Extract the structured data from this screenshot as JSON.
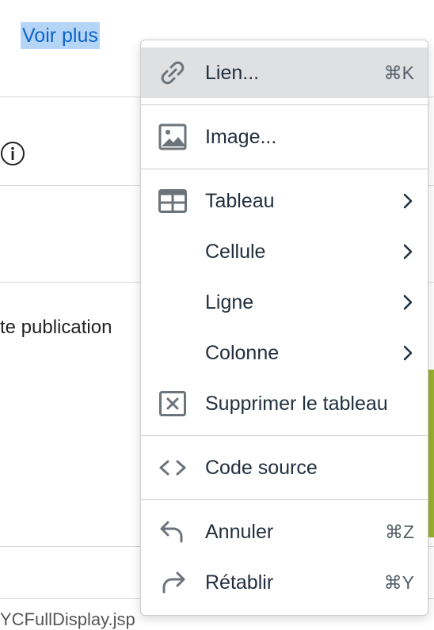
{
  "background": {
    "link_text": "Voir plus",
    "partial_text": "te publication",
    "bottom_text": "YCFullDisplay.jsp"
  },
  "menu": {
    "link": {
      "label": "Lien...",
      "shortcut": "⌘K",
      "icon": "link-icon"
    },
    "image": {
      "label": "Image...",
      "icon": "image-icon"
    },
    "table": {
      "label": "Tableau",
      "icon": "table-icon"
    },
    "cell": {
      "label": "Cellule"
    },
    "row": {
      "label": "Ligne"
    },
    "column": {
      "label": "Colonne"
    },
    "delete_table": {
      "label": "Supprimer le tableau",
      "icon": "delete-table-icon"
    },
    "source_code": {
      "label": "Code source",
      "icon": "source-code-icon"
    },
    "undo": {
      "label": "Annuler",
      "shortcut": "⌘Z",
      "icon": "undo-icon"
    },
    "redo": {
      "label": "Rétablir",
      "shortcut": "⌘Y",
      "icon": "redo-icon"
    }
  },
  "colors": {
    "link": "#0b63c8",
    "selection": "#b5d5f7",
    "active_item": "#dee0e2",
    "text": "#222f3e",
    "accent_strip": "#9ab02f"
  }
}
